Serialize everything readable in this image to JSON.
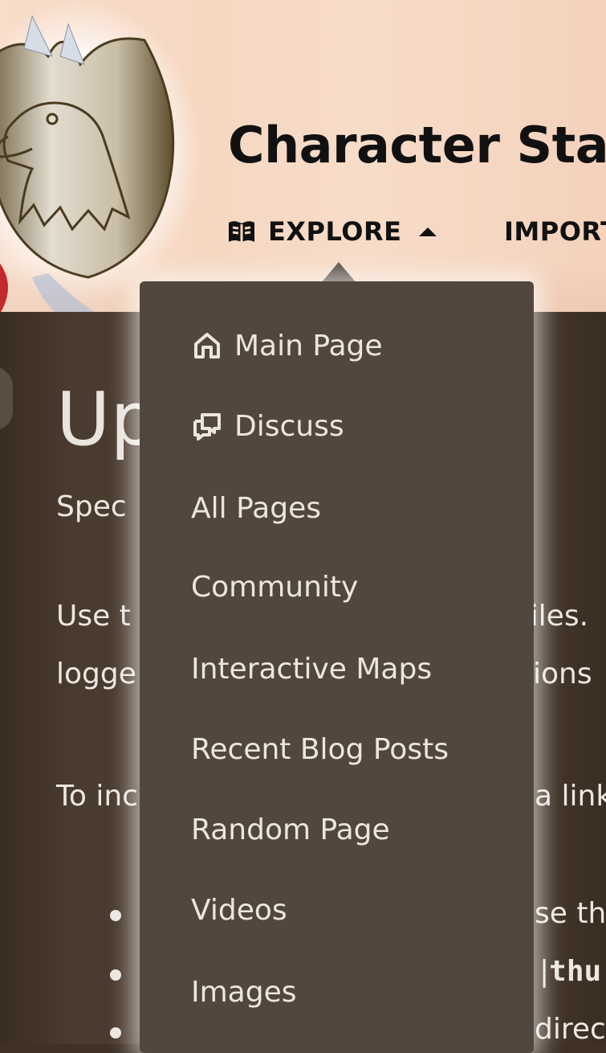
{
  "header": {
    "wiki_title": "Character Sta",
    "nav": {
      "explore_label": "EXPLORE",
      "important_label": "IMPORT"
    }
  },
  "content": {
    "heading": "Up",
    "subtitle": "Spec",
    "para1_line1_left": "Use t",
    "para1_line1_right": "files.",
    "para1_line2_left": "logge",
    "para1_line2_right": "ions",
    "para2_left": "To inc",
    "para2_right": "a link",
    "bullet1_right": "se th",
    "bullet2_right_pipe": "|",
    "bullet2_right_mono": "thu",
    "bullet3_right": "direc"
  },
  "dropdown": {
    "items": [
      {
        "label": "Main Page",
        "icon": "home-icon"
      },
      {
        "label": "Discuss",
        "icon": "discuss-icon"
      },
      {
        "label": "All Pages"
      },
      {
        "label": "Community"
      },
      {
        "label": "Interactive Maps"
      },
      {
        "label": "Recent Blog Posts"
      },
      {
        "label": "Random Page"
      },
      {
        "label": "Videos"
      },
      {
        "label": "Images"
      }
    ]
  },
  "colors": {
    "header_bg": "#f6d8c2",
    "dropdown_bg": "#52473d",
    "content_bg": "#3d2f24",
    "text_light": "#ece6df",
    "text_dark": "#111111"
  }
}
